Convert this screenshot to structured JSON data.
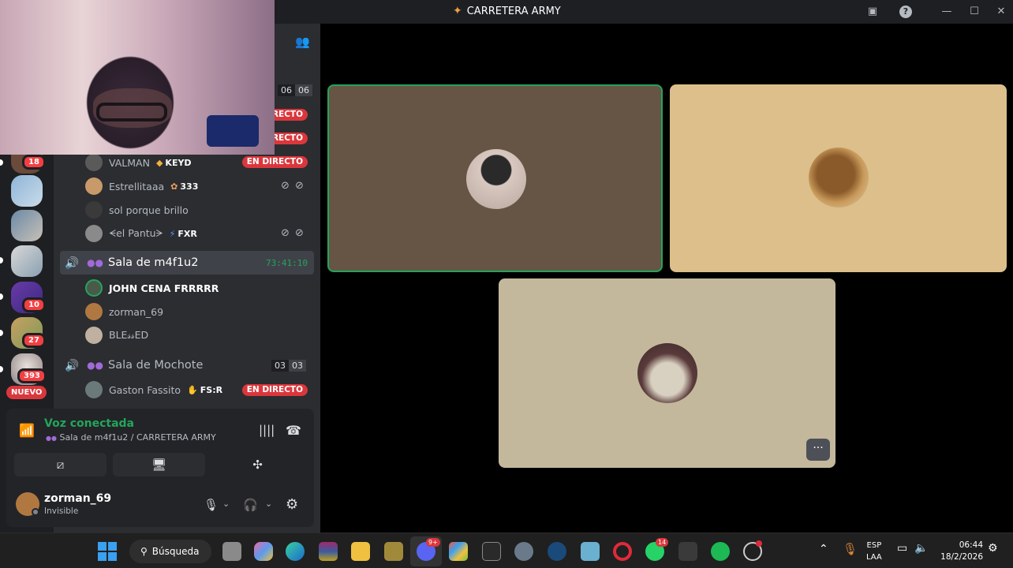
{
  "window": {
    "title": "CARRETERA ARMY",
    "accent": "#23a55a",
    "live_color": "#da373c"
  },
  "rail": {
    "badges": [
      "18",
      "10",
      "27",
      "393"
    ],
    "new_label": "NUEVO"
  },
  "header_counts": [
    "06",
    "06"
  ],
  "live_label": "EN DIRECTO",
  "voice_users_top": [
    {
      "name": "VALMAN",
      "tag": "KEYD",
      "live": true
    },
    {
      "name": "Estrellitaaa",
      "tag": "333",
      "live": false,
      "muted": true
    },
    {
      "name": "sol porque brillo",
      "tag": "",
      "live": false
    },
    {
      "name": "ᗕel Pantuᗒ",
      "tag": "FXR",
      "live": false,
      "muted": true
    }
  ],
  "channel_active": {
    "name": "Sala de m4f1u2",
    "timer": "73:41:10",
    "users": [
      "JOHN CENA FRRRRR",
      "zorman_69",
      "BLE𝓈𝓈ED"
    ]
  },
  "channel_2": {
    "name": "Sala de Mochote",
    "counts": [
      "03",
      "03"
    ],
    "users": [
      {
        "name": "Gaston Fassito",
        "tag": "FS:R",
        "live": true
      }
    ]
  },
  "voice_panel": {
    "status": "Voz conectada",
    "location": "Sala de m4f1u2 / CARRETERA ARMY"
  },
  "user": {
    "name": "zorman_69",
    "status": "Invisible"
  },
  "taskbar": {
    "search_label": "Búsqueda",
    "discord_badge": "9+",
    "whatsapp_badge": "14",
    "lang_top": "ESP",
    "lang_bottom": "LAA",
    "time": "06:44",
    "date": "18/2/2026"
  }
}
